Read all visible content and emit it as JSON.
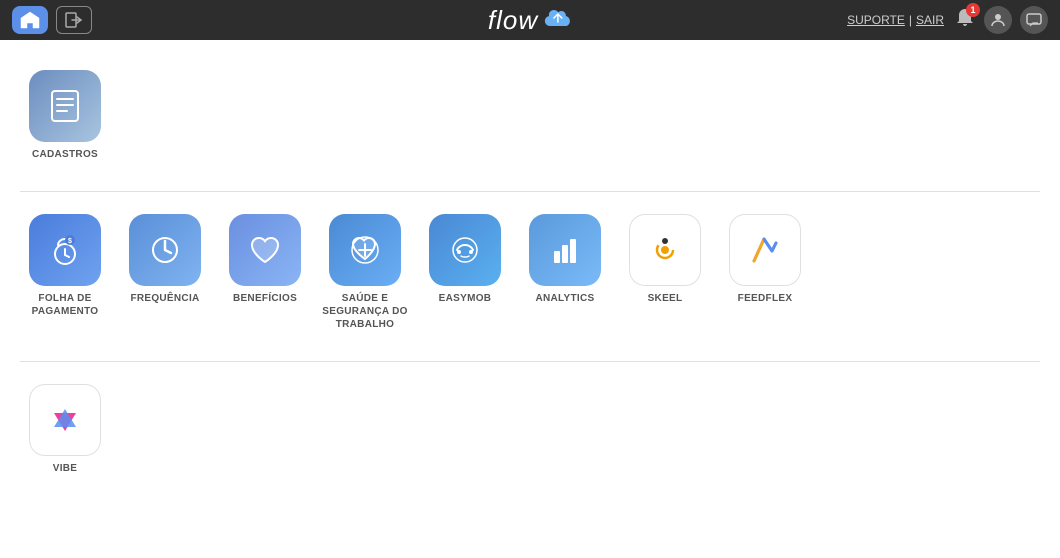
{
  "header": {
    "logo": "flow",
    "suporte_label": "SUPORTE",
    "separator": "|",
    "sair_label": "SAIR",
    "bell_badge": "1"
  },
  "sections": [
    {
      "id": "section1",
      "apps": [
        {
          "id": "cadastros",
          "label": "CADASTROS",
          "icon_type": "cadastros"
        }
      ]
    },
    {
      "id": "section2",
      "apps": [
        {
          "id": "folha",
          "label": "FOLHA DE\nPAGAMENTO",
          "icon_type": "folha"
        },
        {
          "id": "frequencia",
          "label": "FREQUÊNCIA",
          "icon_type": "frequencia"
        },
        {
          "id": "beneficios",
          "label": "BENEFÍCIOS",
          "icon_type": "beneficios"
        },
        {
          "id": "saude",
          "label": "SAÚDE E\nSEGURANÇA DO\nTRABALHO",
          "icon_type": "saude"
        },
        {
          "id": "easymob",
          "label": "EASYMOB",
          "icon_type": "easymob"
        },
        {
          "id": "analytics",
          "label": "ANALYTICS",
          "icon_type": "analytics"
        },
        {
          "id": "skeel",
          "label": "SKEEL",
          "icon_type": "skeel"
        },
        {
          "id": "feedflex",
          "label": "FEEDFLEX",
          "icon_type": "feedflex"
        }
      ]
    },
    {
      "id": "section3",
      "apps": [
        {
          "id": "vibe",
          "label": "VIBE",
          "icon_type": "vibe"
        }
      ]
    }
  ]
}
